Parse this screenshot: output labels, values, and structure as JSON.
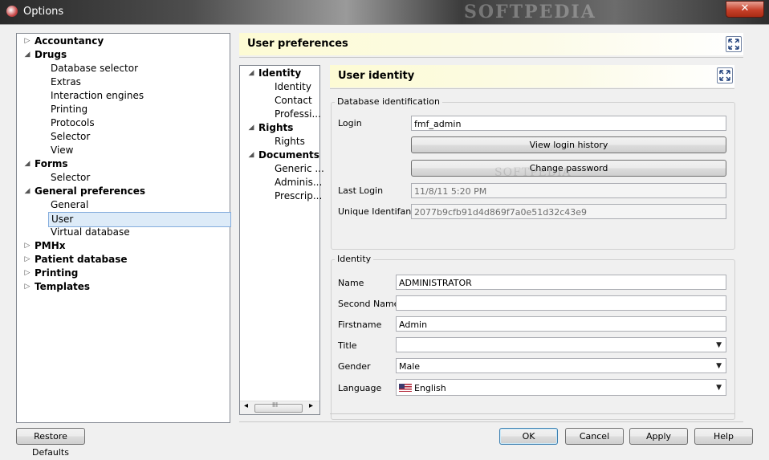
{
  "window": {
    "title": "Options",
    "watermark": "SOFTPEDIA",
    "close": "✕"
  },
  "left_tree": [
    {
      "label": "Accountancy",
      "bold": true,
      "arrow": "▷"
    },
    {
      "label": "Drugs",
      "bold": true,
      "arrow": "◢"
    },
    {
      "label": "Database selector"
    },
    {
      "label": "Extras"
    },
    {
      "label": "Interaction engines"
    },
    {
      "label": "Printing"
    },
    {
      "label": "Protocols"
    },
    {
      "label": "Selector"
    },
    {
      "label": "View"
    },
    {
      "label": "Forms",
      "bold": true,
      "arrow": "◢"
    },
    {
      "label": "Selector"
    },
    {
      "label": "General preferences",
      "bold": true,
      "arrow": "◢"
    },
    {
      "label": "General"
    },
    {
      "label": "User",
      "selected": true
    },
    {
      "label": "Virtual database"
    },
    {
      "label": "PMHx",
      "bold": true,
      "arrow": "▷"
    },
    {
      "label": "Patient database",
      "bold": true,
      "arrow": "▷"
    },
    {
      "label": "Printing",
      "bold": true,
      "arrow": "▷"
    },
    {
      "label": "Templates",
      "bold": true,
      "arrow": "▷"
    }
  ],
  "user_preferences": {
    "title": "User preferences"
  },
  "middle_tree": [
    {
      "label": "Identity",
      "bold": true,
      "arrow": "◢"
    },
    {
      "label": "Identity"
    },
    {
      "label": "Contact"
    },
    {
      "label": "Professi..."
    },
    {
      "label": "Rights",
      "bold": true,
      "arrow": "◢"
    },
    {
      "label": "Rights"
    },
    {
      "label": "Documents",
      "bold": true,
      "arrow": "◢"
    },
    {
      "label": "Generic ..."
    },
    {
      "label": "Adminis..."
    },
    {
      "label": "Prescrip..."
    }
  ],
  "scroll": {
    "left": "◂",
    "right": "▸",
    "grip": "III"
  },
  "user_identity": {
    "title": "User identity",
    "db_group": {
      "title": "Database identification",
      "login_label": "Login",
      "login_value": "fmf_admin",
      "view_history": "View login history",
      "change_password": "Change password",
      "last_login_label": "Last Login",
      "last_login_value": "11/8/11 5:20 PM",
      "uid_label": "Unique Identifant",
      "uid_value": "2077b9cfb91d4d869f7a0e51d32c43e9",
      "watermark": "SOFTPEDIA"
    },
    "identity_group": {
      "title": "Identity",
      "name_label": "Name",
      "name_value": "ADMINISTRATOR",
      "second_name_label": "Second Name",
      "second_name_value": "",
      "firstname_label": "Firstname",
      "firstname_value": "Admin",
      "title_label": "Title",
      "title_value": "",
      "gender_label": "Gender",
      "gender_value": "Male",
      "language_label": "Language",
      "language_value": "English"
    }
  },
  "buttons": {
    "restore_defaults": "Restore Defaults",
    "ok": "OK",
    "cancel": "Cancel",
    "apply": "Apply",
    "help": "Help"
  },
  "combo_arrow": "▼"
}
